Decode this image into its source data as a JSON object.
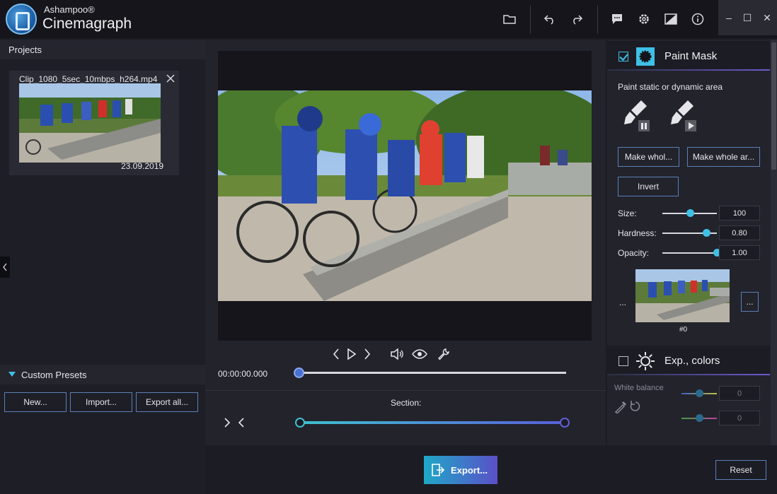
{
  "app": {
    "brand_small": "Ashampoo®",
    "brand_large": "Cinemagraph"
  },
  "toolbar": {
    "icons": [
      "folder-icon",
      "undo-icon",
      "redo-icon",
      "feedback-icon",
      "settings-icon",
      "compare-icon",
      "info-icon"
    ]
  },
  "window": {
    "minimize": "–",
    "maximize": "☐",
    "close": "✕"
  },
  "projects": {
    "header": "Projects",
    "items": [
      {
        "name": "Clip_1080_5sec_10mbps_h264.mp4",
        "date": "23.09.2019"
      }
    ]
  },
  "presets": {
    "header": "Custom Presets",
    "new_label": "New...",
    "import_label": "Import...",
    "export_all_label": "Export all..."
  },
  "player": {
    "timecode": "00:00:00.000",
    "timeline_position": 0.0,
    "section_label": "Section:",
    "section_start": 0.0,
    "section_end": 1.0
  },
  "paint_mask": {
    "title": "Paint Mask",
    "enabled": true,
    "subtitle": "Paint static or dynamic area",
    "make_whole_static_label": "Make whol...",
    "make_whole_dynamic_label": "Make whole ar...",
    "invert_label": "Invert",
    "size_label": "Size:",
    "size_value": "100",
    "size_fraction": 0.5,
    "hardness_label": "Hardness:",
    "hardness_value": "0.80",
    "hardness_fraction": 0.8,
    "opacity_label": "Opacity:",
    "opacity_value": "1.00",
    "opacity_fraction": 1.0,
    "prev_label": "...",
    "more_label": "...",
    "frame_label": "#0"
  },
  "exp_colors": {
    "title": "Exp., colors",
    "enabled": false,
    "white_balance_label": "White balance",
    "wb_value_1": "0",
    "wb_value_2": "0"
  },
  "actions": {
    "export_label": "Export...",
    "reset_label": "Reset"
  },
  "colors": {
    "accent": "#3fc0e6",
    "button_border": "#5a7fb8"
  }
}
